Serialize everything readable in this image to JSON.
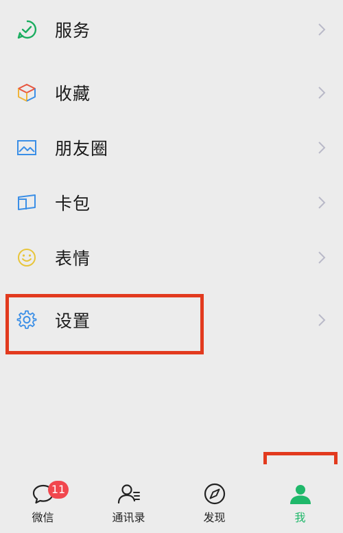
{
  "menu": {
    "items": [
      {
        "label": "服务",
        "icon": "service-check-icon"
      },
      {
        "label": "收藏",
        "icon": "favorites-cube-icon"
      },
      {
        "label": "朋友圈",
        "icon": "moments-picture-icon"
      },
      {
        "label": "卡包",
        "icon": "card-wallet-icon"
      },
      {
        "label": "表情",
        "icon": "smiley-emoji-icon"
      },
      {
        "label": "设置",
        "icon": "gear-settings-icon"
      }
    ]
  },
  "tabbar": {
    "tabs": [
      {
        "label": "微信",
        "icon": "chat-bubble-icon",
        "badge": "11"
      },
      {
        "label": "通讯录",
        "icon": "contacts-icon"
      },
      {
        "label": "发现",
        "icon": "compass-icon"
      },
      {
        "label": "我",
        "icon": "person-icon",
        "active": true
      }
    ]
  },
  "colors": {
    "accent": "#1fb86a",
    "highlight": "#e23a1e",
    "badge": "#f1474e",
    "background": "#ececec"
  }
}
